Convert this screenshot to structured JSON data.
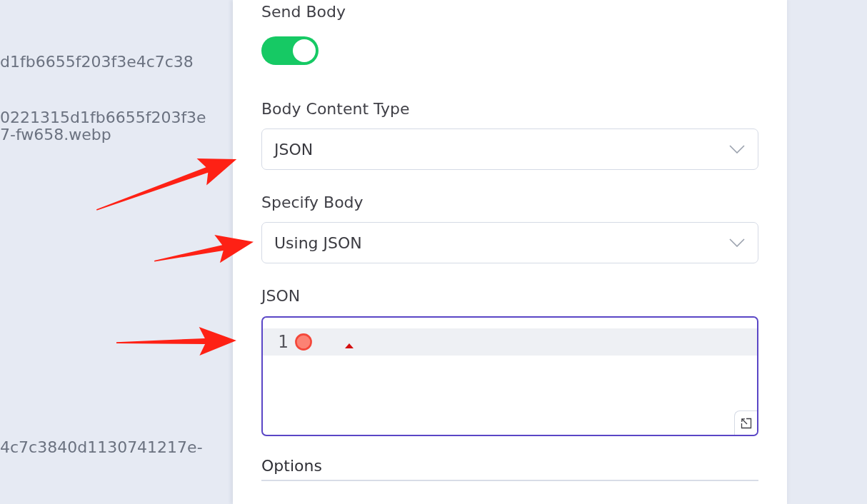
{
  "background_list": {
    "items": [
      {
        "lines": [
          "d1fb6655f203f3e4c7c38"
        ]
      },
      {
        "lines": [
          "0221315d1fb6655f203f3e",
          "7-fw658.webp"
        ]
      },
      {
        "lines": [
          "4c7c3840d1130741217e-"
        ]
      }
    ]
  },
  "panel": {
    "fields": [
      {
        "kind": "toggle",
        "label": "Send Body",
        "on": true
      },
      {
        "kind": "select",
        "label": "Body Content Type",
        "value": "JSON"
      },
      {
        "kind": "select",
        "label": "Specify Body",
        "value": "Using JSON"
      },
      {
        "kind": "code",
        "label": "JSON",
        "focused": true,
        "lines": [
          {
            "number": "1",
            "active": true,
            "error": true
          }
        ]
      }
    ],
    "section_title": "Options"
  },
  "annotations": [
    {
      "kind": "arrow"
    },
    {
      "kind": "arrow"
    },
    {
      "kind": "arrow"
    }
  ]
}
